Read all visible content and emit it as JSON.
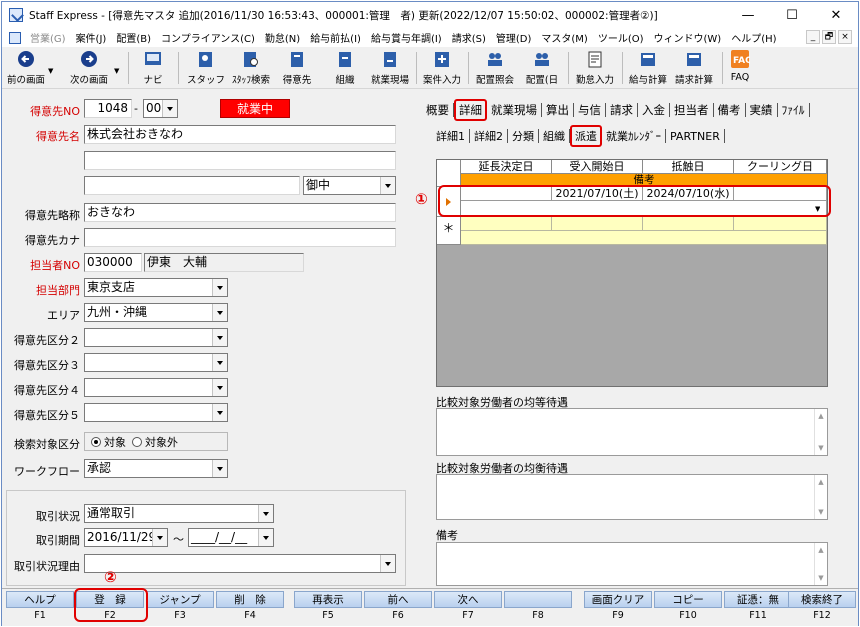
{
  "window": {
    "title": "Staff Express - [得意先マスタ 追加(2016/11/30 16:53:43、000001:管理　者) 更新(2022/12/07 15:50:02、000002:管理者②)]",
    "controls": {
      "minimize": "—",
      "maximize": "☐",
      "close": "✕"
    }
  },
  "menubar": {
    "items": [
      {
        "label": "営業(G)",
        "disabled": true
      },
      {
        "label": "案件(J)"
      },
      {
        "label": "配置(B)"
      },
      {
        "label": "コンプライアンス(C)"
      },
      {
        "label": "勤怠(N)"
      },
      {
        "label": "給与前払(I)"
      },
      {
        "label": "給与賞与年調(I)"
      },
      {
        "label": "請求(S)"
      },
      {
        "label": "管理(D)"
      },
      {
        "label": "マスタ(M)"
      },
      {
        "label": "ツール(O)"
      },
      {
        "label": "ウィンドウ(W)"
      },
      {
        "label": "ヘルプ(H)"
      }
    ],
    "mdi": [
      "_",
      "🗗",
      "×"
    ]
  },
  "toolbar": {
    "buttons": [
      {
        "label": "前の画面",
        "icon": "back-arrow-icon"
      },
      {
        "label": "次の画面",
        "icon": "forward-arrow-icon"
      },
      {
        "label": "ナビ",
        "icon": "navi-icon"
      },
      {
        "label": "スタッフ",
        "icon": "staff-icon"
      },
      {
        "label": "ｽﾀｯﾌ検索",
        "icon": "staff-search-icon"
      },
      {
        "label": "得意先",
        "icon": "customer-icon"
      },
      {
        "label": "組織",
        "icon": "organization-icon"
      },
      {
        "label": "就業現場",
        "icon": "worksite-icon"
      },
      {
        "label": "案件入力",
        "icon": "case-input-icon"
      },
      {
        "label": "配置照会",
        "icon": "assignment-inquiry-icon"
      },
      {
        "label": "配置(日",
        "icon": "assignment-daily-icon"
      },
      {
        "label": "勤怠入力",
        "icon": "attendance-input-icon"
      },
      {
        "label": "給与計算",
        "icon": "payroll-icon"
      },
      {
        "label": "請求計算",
        "icon": "billing-icon"
      },
      {
        "label": "FAQ",
        "icon": "faq-icon"
      }
    ]
  },
  "form": {
    "customer_no_label": "得意先NO",
    "customer_no": "1048",
    "customer_no_dash": "-",
    "branch_no": "000",
    "status_badge": "就業中",
    "customer_name_label": "得意先名",
    "customer_name": "株式会社おきなわ",
    "honorific": "御中",
    "short_name_label": "得意先略称",
    "short_name": "おきなわ",
    "kana_label": "得意先カナ",
    "kana": "",
    "person_no_label": "担当者NO",
    "person_no": "030000",
    "person_name": "伊東　大輔",
    "dept_label": "担当部門",
    "dept": "東京支店",
    "area_label": "エリア",
    "area": "九州・沖縄",
    "class2_label": "得意先区分２",
    "class3_label": "得意先区分３",
    "class4_label": "得意先区分４",
    "class5_label": "得意先区分５",
    "search_label": "検索対象区分",
    "search_opt_on": "対象",
    "search_opt_off": "対象外",
    "workflow_label": "ワークフロー",
    "workflow": "承認",
    "trade_status_label": "取引状況",
    "trade_status": "通常取引",
    "trade_period_label": "取引期間",
    "trade_from": "2016/11/29",
    "trade_tilde": "～",
    "trade_to": "____/__/__",
    "trade_reason_label": "取引状況理由"
  },
  "tabs": {
    "top": [
      "概要",
      "詳細",
      "就業現場",
      "算出",
      "与信",
      "請求",
      "入金",
      "担当者",
      "備考",
      "実績",
      "ﾌｧｲﾙ"
    ],
    "top_active_index": 1,
    "sub": [
      "詳細1",
      "詳細2",
      "分類",
      "組織",
      "派遣",
      "就業ｶﾚﾝﾀﾞｰ",
      "PARTNER"
    ],
    "sub_active_index": 4
  },
  "grid": {
    "columns": [
      "延長決定日",
      "受入開始日",
      "抵触日",
      "クーリング日"
    ],
    "subheader": "備考",
    "row": [
      "",
      "2021/07/10(土)",
      "2024/07/10(水)",
      ""
    ],
    "new_row_marker": "＊"
  },
  "annotations": {
    "one": "①",
    "two": "②"
  },
  "sections": {
    "equal_label": "比較対象労働者の均等待遇",
    "balance_label": "比較対象労働者の均衡待遇",
    "memo_label": "備考"
  },
  "fkeys": [
    {
      "label": "ヘルプ",
      "key": "F1"
    },
    {
      "label": "登　録",
      "key": "F2"
    },
    {
      "label": "ジャンプ",
      "key": "F3"
    },
    {
      "label": "削　除",
      "key": "F4"
    },
    {
      "label": "再表示",
      "key": "F5"
    },
    {
      "label": "前へ",
      "key": "F6"
    },
    {
      "label": "次へ",
      "key": "F7"
    },
    {
      "label": "",
      "key": "F8"
    },
    {
      "label": "画面クリア",
      "key": "F9"
    },
    {
      "label": "コピー",
      "key": "F10"
    },
    {
      "label": "証憑：無",
      "key": "F11"
    },
    {
      "label": "検索終了",
      "key": "F12"
    }
  ],
  "colors": {
    "accent_red": "#e00000",
    "badge_red": "#ff0000",
    "grid_header_orange": "#ffa000"
  }
}
